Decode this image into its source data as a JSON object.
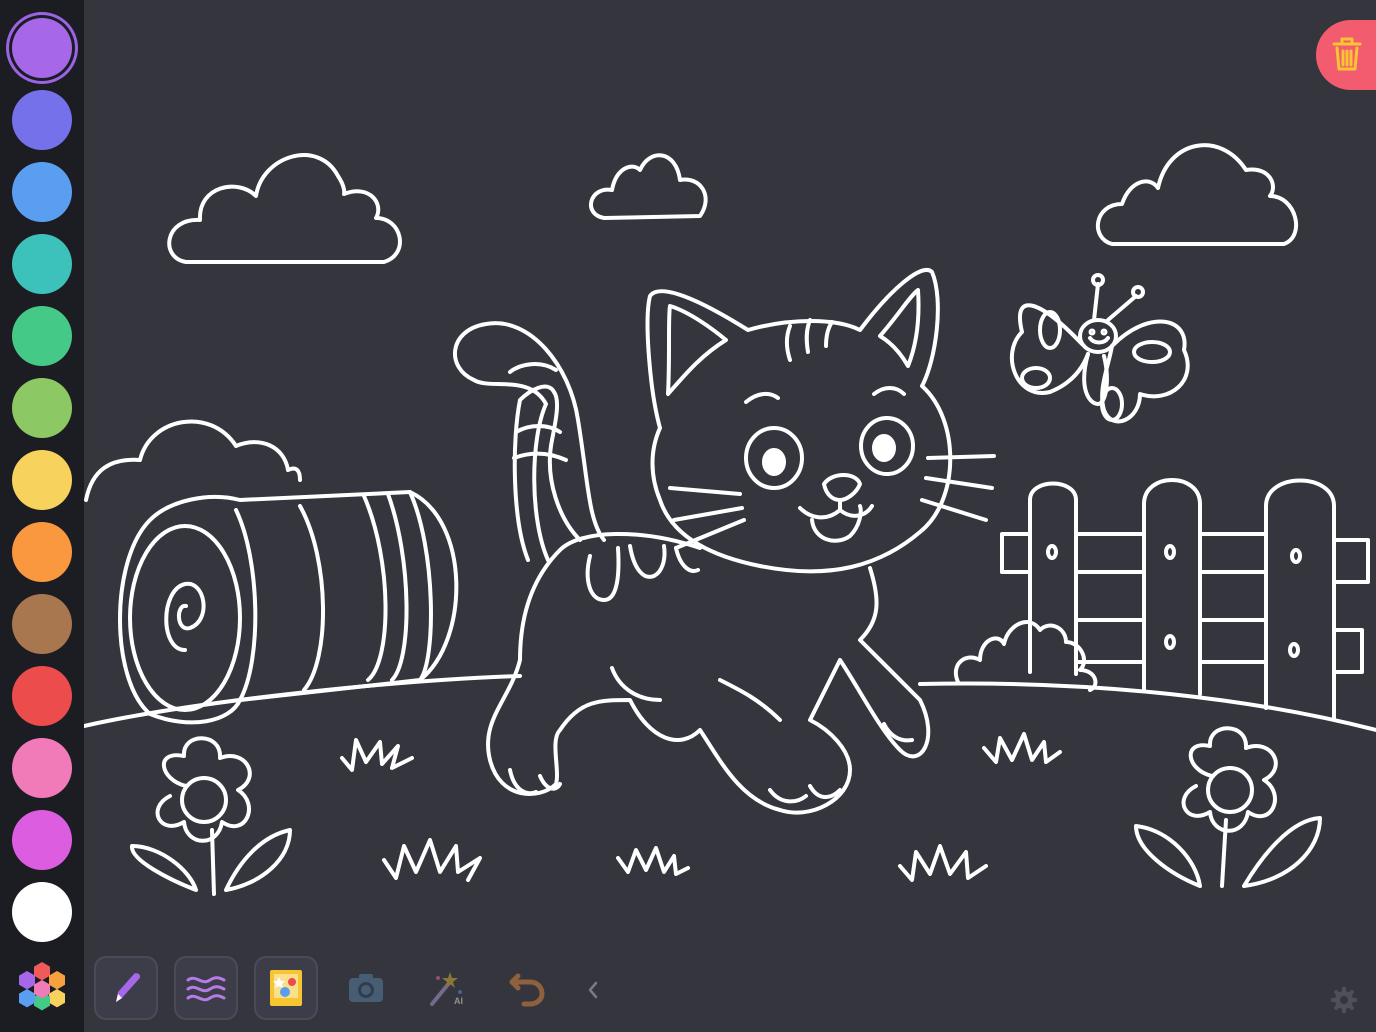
{
  "palette": {
    "colors": [
      "#a667e8",
      "#7471ea",
      "#5a9ef1",
      "#3cc2bb",
      "#45c987",
      "#8cc964",
      "#f7d25d",
      "#f9983f",
      "#a8764f",
      "#ec4c4c",
      "#f17bb8",
      "#dd5de0",
      "#ffffff"
    ],
    "selected_color": "#a667e8"
  },
  "toolbar": {
    "tools": [
      {
        "icon": "pencil-icon",
        "enabled": true
      },
      {
        "icon": "waves-icon",
        "enabled": true
      },
      {
        "icon": "gallery-icon",
        "enabled": true
      },
      {
        "icon": "camera-icon",
        "enabled": false
      },
      {
        "icon": "magic-wand-icon",
        "enabled": false,
        "badge": "AI"
      },
      {
        "icon": "undo-icon",
        "enabled": false
      }
    ]
  },
  "top_actions": {
    "trash_icon": "trash-icon",
    "trash_color": "#f25c6e"
  },
  "bottom_right": {
    "settings_icon": "gear-icon"
  },
  "canvas": {
    "line_color": "#ffffff",
    "background": "#34353d"
  }
}
